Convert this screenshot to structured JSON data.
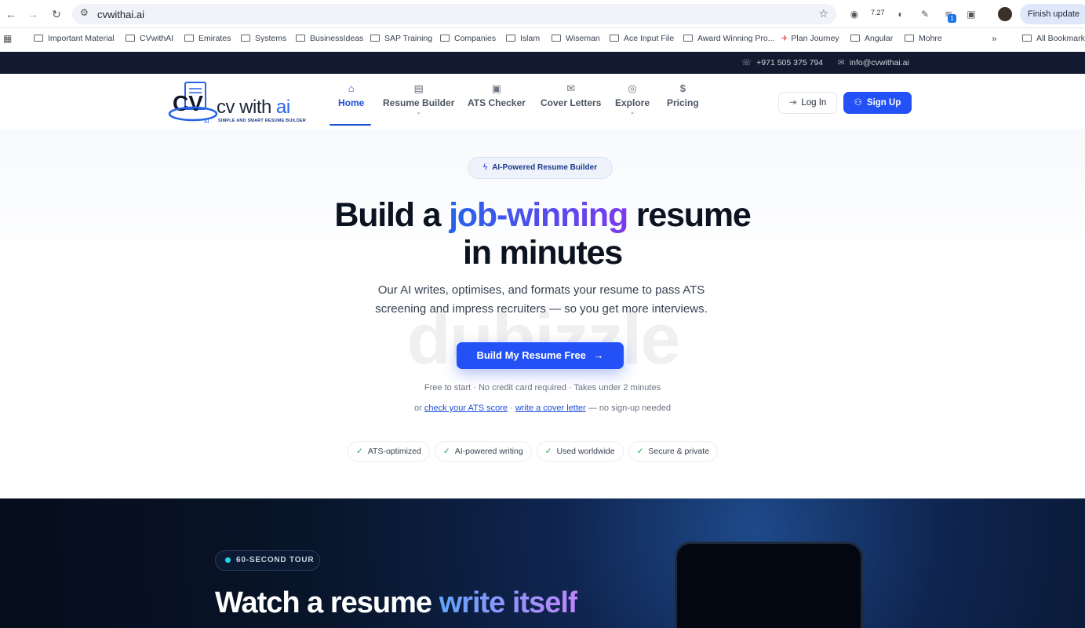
{
  "browser": {
    "url": "cvwithai.ai",
    "ext_count": "7.27",
    "ext_badge": "1",
    "finish_update": "Finish update"
  },
  "bookmarks": [
    "Important Material",
    "CVwithAI",
    "Emirates",
    "Systems",
    "BusinessIdeas",
    "SAP Training",
    "Companies",
    "Islam",
    "Wiseman",
    "Ace Input File",
    "Award Winning Pro...",
    "Plan Journey",
    "Angular",
    "Mohre",
    "All Bookmarks"
  ],
  "topbar": {
    "phone": "+971 505 375 794",
    "email": "info@cvwithai.ai"
  },
  "logo": {
    "brand_prefix": "cv with ",
    "brand_ai": "ai",
    "tagline": "SIMPLE AND SMART RESUME BUILDER"
  },
  "nav": [
    {
      "label": "Home",
      "icon": "home-icon"
    },
    {
      "label": "Resume Builder",
      "icon": "document-icon"
    },
    {
      "label": "ATS Checker",
      "icon": "id-card-icon"
    },
    {
      "label": "Cover Letters",
      "icon": "envelope-icon"
    },
    {
      "label": "Explore",
      "icon": "compass-icon"
    },
    {
      "label": "Pricing",
      "icon": "dollar-icon"
    }
  ],
  "auth": {
    "login": "Log In",
    "signup": "Sign Up"
  },
  "hero": {
    "pill": "AI-Powered Resume Builder",
    "title_a": "Build a ",
    "title_highlight": "job-winning",
    "title_b": " resume",
    "title_c": "in minutes",
    "subtitle": "Our AI writes, optimises, and formats your resume to pass ATS screening and impress recruiters — so you get more interviews.",
    "cta": "Build My Resume Free",
    "note": "Free to start · No credit card required · Takes under 2 minutes",
    "links_prefix": "or ",
    "link_ats": "check your ATS score",
    "links_sep": " · ",
    "link_cover": "write a cover letter",
    "links_suffix": " — no sign-up needed",
    "badges": [
      "ATS-optimized",
      "AI-powered writing",
      "Used worldwide",
      "Secure & private"
    ]
  },
  "watermark": "dubizzle",
  "tour": {
    "pill": "60-SECOND TOUR",
    "title_a": "Watch a resume ",
    "title_highlight": "write itself"
  }
}
